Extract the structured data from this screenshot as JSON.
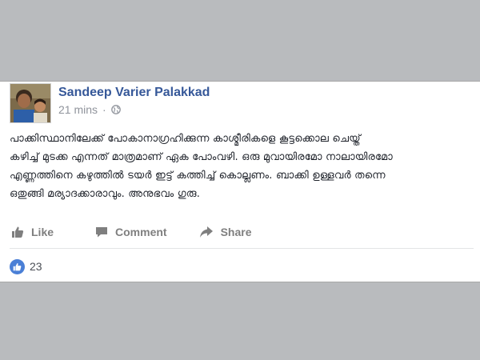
{
  "post": {
    "author": "Sandeep Varier Palakkad",
    "timestamp": "21 mins",
    "separator": "·",
    "privacy_icon": "globe-icon",
    "body_lines": [
      "പാക്കിസ്ഥാനിലേക്ക് പോകാനാഗ്രഹിക്കുന്ന കാശ്മീരികളെ കൂട്ടക്കൊല ചെയ്ത്",
      "കഴിച്ച് മുടക്ക എന്നത് മാത്രമാണ് ഏക പോംവഴി. ഒരു മുവായിരമോ നാലായിരമോ",
      "എണ്ണത്തിനെ കഴുത്തിൽ ടയർ ഇട്ട് കത്തിച്ച് കൊല്ലണം. ബാക്കി ഉള്ളവർ തന്നെ",
      "ഒതുങ്ങി മര്യാദക്കാരാവും. അനുഭവം ഗുരു."
    ]
  },
  "actions": {
    "like": "Like",
    "comment": "Comment",
    "share": "Share"
  },
  "reactions": {
    "count": "23",
    "icon": "thumbs-up-icon"
  },
  "colors": {
    "author": "#365899",
    "meta": "#90949c",
    "action": "#7f7f7f",
    "like_badge": "#4a7fd6",
    "background": "#b9bbbe"
  }
}
